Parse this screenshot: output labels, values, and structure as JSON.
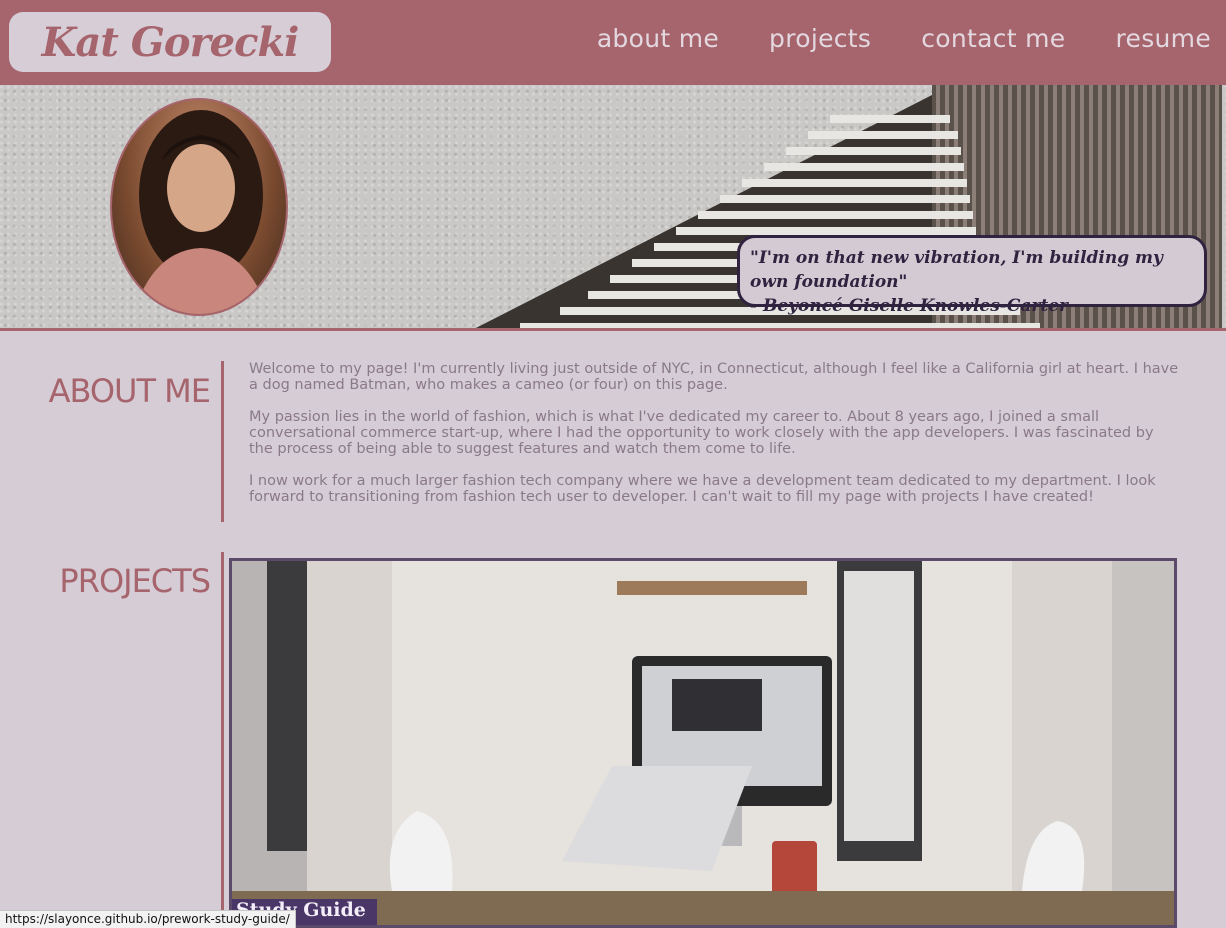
{
  "header": {
    "logo": "Kat Gorecki",
    "nav": [
      "about me",
      "projects",
      "contact me",
      "resume"
    ]
  },
  "hero": {
    "quote_line1": "\"I'm on that new vibration, I'm building my own foundation\"",
    "quote_line2": "- Beyoncé Giselle Knowles-Carter"
  },
  "about": {
    "title": "ABOUT ME",
    "paragraphs": [
      "Welcome to my page! I'm currently living just outside of NYC, in Connecticut, although I feel like a California girl at heart. I have a dog named Batman, who makes a cameo (or four) on this page.",
      "My passion lies in the world of fashion, which is what I've dedicated my career to. About 8 years ago, I joined a small conversational commerce start-up, where I had the opportunity to work closely with the app developers. I was fascinated by the process of being able to suggest features and watch them come to life.",
      "I now work for a much larger fashion tech company where we have a development team dedicated to my department. I look forward to transitioning from fashion tech user to developer. I can't wait to fill my page with projects I have created!"
    ]
  },
  "projects": {
    "title": "PROJECTS",
    "card_label": "Study Guide"
  },
  "status": {
    "url": "https://slayonce.github.io/prework-study-guide/"
  },
  "colors": {
    "accent": "#a6646c",
    "background": "#d6ccd6",
    "dark": "#2f2340"
  }
}
